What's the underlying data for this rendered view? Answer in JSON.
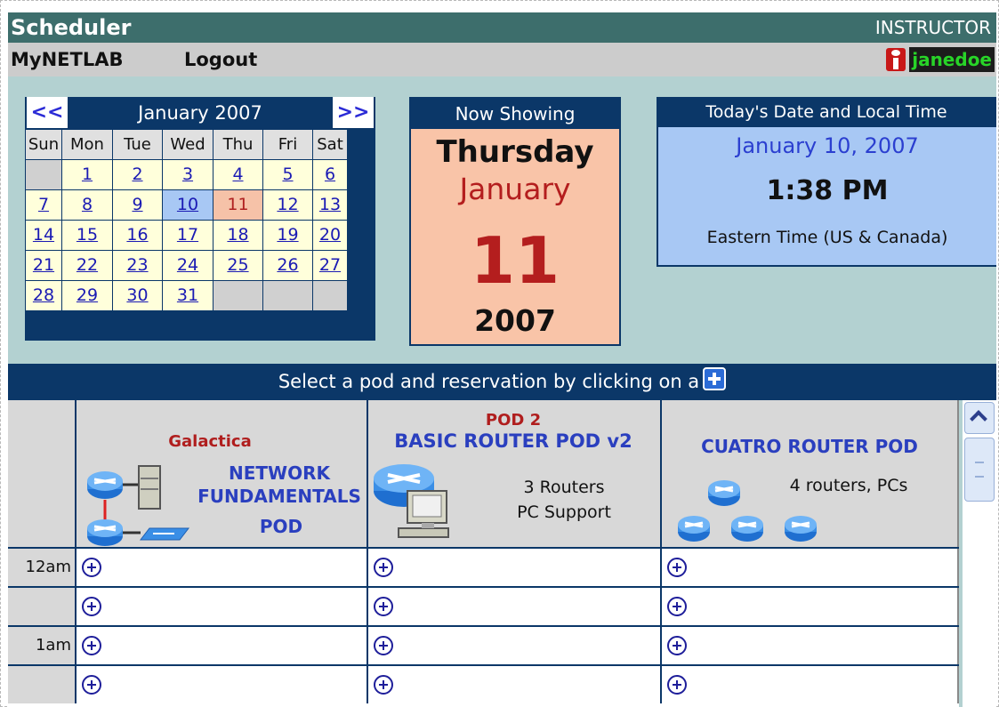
{
  "app": {
    "title": "Scheduler",
    "role": "INSTRUCTOR"
  },
  "menu": {
    "home_label": "MyNETLAB",
    "logout_label": "Logout",
    "username": "janedoe"
  },
  "calendar": {
    "prev_label": "<<",
    "next_label": ">>",
    "month_label": "January 2007",
    "weekdays": [
      "Sun",
      "Mon",
      "Tue",
      "Wed",
      "Thu",
      "Fri",
      "Sat"
    ],
    "weeks": [
      [
        "",
        "1",
        "2",
        "3",
        "4",
        "5",
        "6"
      ],
      [
        "7",
        "8",
        "9",
        "10",
        "11",
        "12",
        "13"
      ],
      [
        "14",
        "15",
        "16",
        "17",
        "18",
        "19",
        "20"
      ],
      [
        "21",
        "22",
        "23",
        "24",
        "25",
        "26",
        "27"
      ],
      [
        "28",
        "29",
        "30",
        "31",
        "",
        "",
        ""
      ]
    ],
    "today": "10",
    "selected": "11"
  },
  "now_showing": {
    "header": "Now Showing",
    "weekday": "Thursday",
    "month": "January",
    "day": "11",
    "year": "2007"
  },
  "today_box": {
    "header": "Today's Date and Local Time",
    "date": "January 10, 2007",
    "time": "1:38 PM",
    "timezone": "Eastern Time (US & Canada)"
  },
  "select_bar": {
    "text": "Select a pod and reservation by clicking on a"
  },
  "pods": [
    {
      "name": "Galactica",
      "title_lines": [
        "NETWORK",
        "FUNDAMENTALS",
        "POD"
      ]
    },
    {
      "name": "POD 2",
      "title": "BASIC ROUTER POD v2",
      "desc_lines": [
        "3 Routers",
        "PC Support"
      ]
    },
    {
      "title": "CUATRO ROUTER POD",
      "desc": "4 routers, PCs"
    }
  ],
  "rows": [
    {
      "time": "12am"
    },
    {
      "time": ""
    },
    {
      "time": "1am"
    },
    {
      "time": ""
    }
  ],
  "colors": {
    "titlebar": "#3d6e6c",
    "navy": "#0b3768",
    "panel_bg": "#b3d1d1",
    "now_showing_bg": "#f9c4a8",
    "today_bg": "#a8c8f4",
    "pod_title": "#2a3fbf",
    "pod_name": "#b01e1e"
  },
  "icons": [
    "user-icon",
    "router-icon",
    "server-icon",
    "switch-icon",
    "pc-icon",
    "plus-icon",
    "scroll-up-icon"
  ]
}
